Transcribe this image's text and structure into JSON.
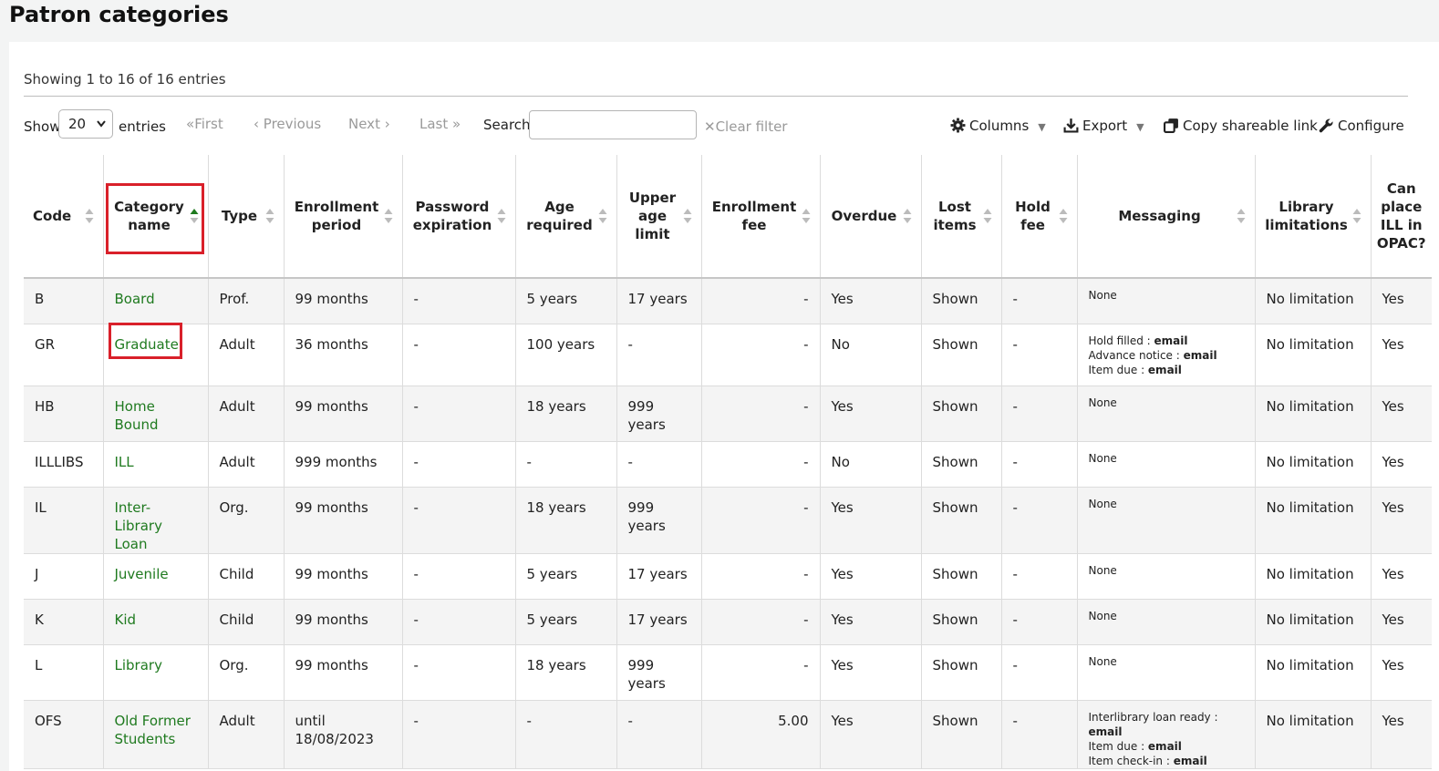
{
  "page": {
    "title": "Patron categories"
  },
  "table_info": "Showing 1 to 16 of 16 entries",
  "toolbar": {
    "show_label": "Show",
    "page_size": "20",
    "entries_label": "entries",
    "first": "First",
    "previous": "Previous",
    "next": "Next",
    "last": "Last",
    "search_label": "Search:",
    "search_value": "",
    "clear_filter": "Clear filter",
    "columns": "Columns",
    "export": "Export",
    "copy_link": "Copy shareable link",
    "configure": "Configure"
  },
  "columns": [
    "Code",
    "Category name",
    "Type",
    "Enrollment period",
    "Password expiration",
    "Age required",
    "Upper age limit",
    "Enrollment fee",
    "Overdue",
    "Lost items",
    "Hold fee",
    "Messaging",
    "Library limitations",
    "Can place ILL in OPAC?"
  ],
  "sorted_column": "Category name",
  "rows": [
    {
      "code": "B",
      "name": "Board",
      "type": "Prof.",
      "enrollment": "99 months",
      "password": "-",
      "age": "5 years",
      "upper": "17 years",
      "fee": "-",
      "overdue": "Yes",
      "lost": "Shown",
      "hold": "-",
      "messaging": [
        {
          "label": "None",
          "value": ""
        }
      ],
      "limit": "No limitation",
      "ill": "Yes"
    },
    {
      "code": "GR",
      "name": "Graduate",
      "type": "Adult",
      "enrollment": "36 months",
      "password": "-",
      "age": "100 years",
      "upper": "-",
      "fee": "-",
      "overdue": "No",
      "lost": "Shown",
      "hold": "-",
      "messaging": [
        {
          "label": "Hold filled",
          "value": "email"
        },
        {
          "label": "Advance notice",
          "value": "email"
        },
        {
          "label": "Item due",
          "value": "email"
        }
      ],
      "limit": "No limitation",
      "ill": "Yes"
    },
    {
      "code": "HB",
      "name": "Home Bound",
      "type": "Adult",
      "enrollment": "99 months",
      "password": "-",
      "age": "18 years",
      "upper": "999 years",
      "fee": "-",
      "overdue": "Yes",
      "lost": "Shown",
      "hold": "-",
      "messaging": [
        {
          "label": "None",
          "value": ""
        }
      ],
      "limit": "No limitation",
      "ill": "Yes"
    },
    {
      "code": "ILLLIBS",
      "name": "ILL",
      "type": "Adult",
      "enrollment": "999 months",
      "password": "-",
      "age": "-",
      "upper": "-",
      "fee": "-",
      "overdue": "No",
      "lost": "Shown",
      "hold": "-",
      "messaging": [
        {
          "label": "None",
          "value": ""
        }
      ],
      "limit": "No limitation",
      "ill": "Yes"
    },
    {
      "code": "IL",
      "name": "Inter-Library Loan",
      "type": "Org.",
      "enrollment": "99 months",
      "password": "-",
      "age": "18 years",
      "upper": "999 years",
      "fee": "-",
      "overdue": "Yes",
      "lost": "Shown",
      "hold": "-",
      "messaging": [
        {
          "label": "None",
          "value": ""
        }
      ],
      "limit": "No limitation",
      "ill": "Yes"
    },
    {
      "code": "J",
      "name": "Juvenile",
      "type": "Child",
      "enrollment": "99 months",
      "password": "-",
      "age": "5 years",
      "upper": "17 years",
      "fee": "-",
      "overdue": "Yes",
      "lost": "Shown",
      "hold": "-",
      "messaging": [
        {
          "label": "None",
          "value": ""
        }
      ],
      "limit": "No limitation",
      "ill": "Yes"
    },
    {
      "code": "K",
      "name": "Kid",
      "type": "Child",
      "enrollment": "99 months",
      "password": "-",
      "age": "5 years",
      "upper": "17 years",
      "fee": "-",
      "overdue": "Yes",
      "lost": "Shown",
      "hold": "-",
      "messaging": [
        {
          "label": "None",
          "value": ""
        }
      ],
      "limit": "No limitation",
      "ill": "Yes"
    },
    {
      "code": "L",
      "name": "Library",
      "type": "Org.",
      "enrollment": "99 months",
      "password": "-",
      "age": "18 years",
      "upper": "999 years",
      "fee": "-",
      "overdue": "Yes",
      "lost": "Shown",
      "hold": "-",
      "messaging": [
        {
          "label": "None",
          "value": ""
        }
      ],
      "limit": "No limitation",
      "ill": "Yes"
    },
    {
      "code": "OFS",
      "name": "Old Former Students",
      "type": "Adult",
      "enrollment": "until 18/08/2023",
      "password": "-",
      "age": "-",
      "upper": "-",
      "fee": "5.00",
      "overdue": "Yes",
      "lost": "Shown",
      "hold": "-",
      "messaging": [
        {
          "label": "Interlibrary loan ready",
          "value": "email"
        },
        {
          "label": "Item due",
          "value": "email"
        },
        {
          "label": "Item check-in",
          "value": "email"
        }
      ],
      "limit": "No limitation",
      "ill": "Yes"
    }
  ],
  "colors": {
    "link": "#1f7a1f",
    "highlight_box": "#d9202a",
    "sort_active": "#1f7a1f"
  },
  "icons": [
    "chevrons-left-icon",
    "chevron-left-icon",
    "chevron-right-icon",
    "chevrons-right-icon",
    "close-icon",
    "gear-icon",
    "download-icon",
    "copy-icon",
    "wrench-icon",
    "sort-icon",
    "sort-asc-icon",
    "chevron-down-icon"
  ]
}
